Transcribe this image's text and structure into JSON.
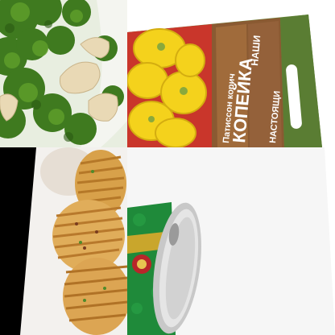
{
  "image": {
    "tiles": [
      {
        "name": "broccoli-salad",
        "subject": "broccoli with cashew nuts"
      },
      {
        "name": "seed-packet",
        "subject": "pattypan squash seed packet"
      },
      {
        "name": "baked-potato",
        "subject": "hasselback potatoes"
      },
      {
        "name": "green-can",
        "subject": "tin can with green label"
      }
    ],
    "seed_packet": {
      "brand_line_1": "НАШИ",
      "brand_line_2": "НАСТОЯЩИ",
      "product_name": "КОПЕЙКА",
      "product_type": "Патиссон корич"
    }
  }
}
